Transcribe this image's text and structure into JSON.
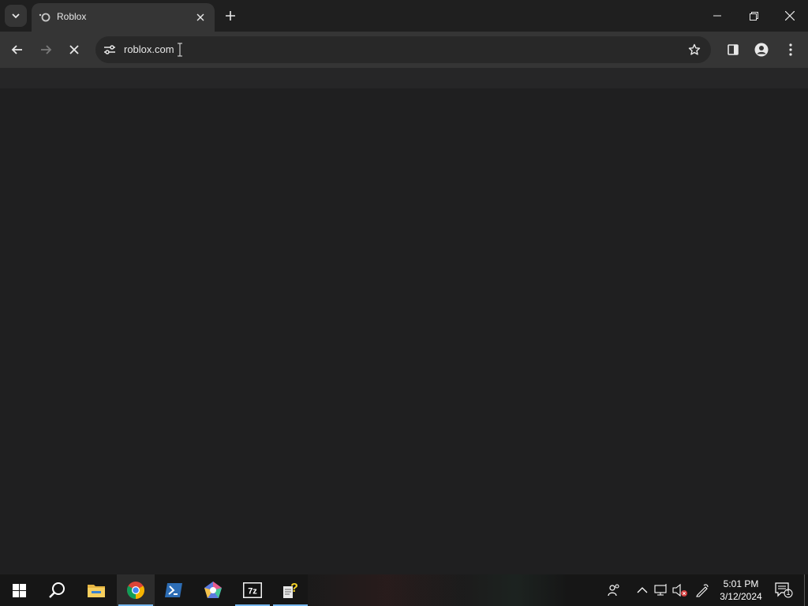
{
  "browser": {
    "tab": {
      "title": "Roblox"
    },
    "address_bar": {
      "value": "roblox.com"
    }
  },
  "taskbar": {
    "items": [
      {
        "name": "start",
        "icon": "windows-logo-icon"
      },
      {
        "name": "search",
        "icon": "search-icon"
      },
      {
        "name": "file-explorer",
        "icon": "folder-icon"
      },
      {
        "name": "chrome",
        "icon": "chrome-icon",
        "active": true
      },
      {
        "name": "powershell",
        "icon": "powershell-icon"
      },
      {
        "name": "app-pentagon",
        "icon": "pentagon-app-icon"
      },
      {
        "name": "7zip",
        "icon": "7zip-icon",
        "label": "7z"
      },
      {
        "name": "help-app",
        "icon": "help-document-icon"
      }
    ],
    "clock": {
      "time": "5:01 PM",
      "date": "3/12/2024"
    },
    "notification_count": "1"
  },
  "colors": {
    "accent": "#77b8f0",
    "content_bg": "#1f1f20",
    "toolbar_bg": "#353535"
  }
}
